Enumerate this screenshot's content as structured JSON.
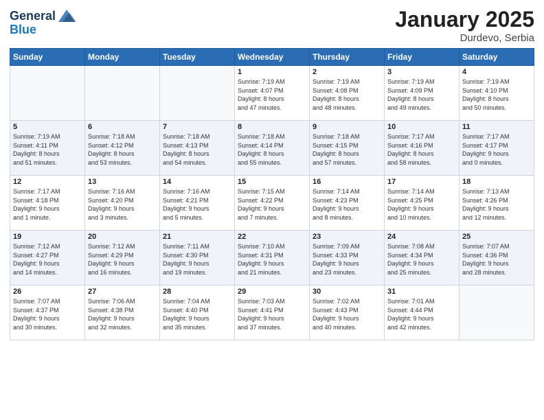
{
  "logo": {
    "line1": "General",
    "line2": "Blue"
  },
  "title": "January 2025",
  "subtitle": "Durdevo, Serbia",
  "days_of_week": [
    "Sunday",
    "Monday",
    "Tuesday",
    "Wednesday",
    "Thursday",
    "Friday",
    "Saturday"
  ],
  "weeks": [
    [
      {
        "day": "",
        "info": ""
      },
      {
        "day": "",
        "info": ""
      },
      {
        "day": "",
        "info": ""
      },
      {
        "day": "1",
        "info": "Sunrise: 7:19 AM\nSunset: 4:07 PM\nDaylight: 8 hours\nand 47 minutes."
      },
      {
        "day": "2",
        "info": "Sunrise: 7:19 AM\nSunset: 4:08 PM\nDaylight: 8 hours\nand 48 minutes."
      },
      {
        "day": "3",
        "info": "Sunrise: 7:19 AM\nSunset: 4:09 PM\nDaylight: 8 hours\nand 49 minutes."
      },
      {
        "day": "4",
        "info": "Sunrise: 7:19 AM\nSunset: 4:10 PM\nDaylight: 8 hours\nand 50 minutes."
      }
    ],
    [
      {
        "day": "5",
        "info": "Sunrise: 7:19 AM\nSunset: 4:11 PM\nDaylight: 8 hours\nand 51 minutes."
      },
      {
        "day": "6",
        "info": "Sunrise: 7:18 AM\nSunset: 4:12 PM\nDaylight: 8 hours\nand 53 minutes."
      },
      {
        "day": "7",
        "info": "Sunrise: 7:18 AM\nSunset: 4:13 PM\nDaylight: 8 hours\nand 54 minutes."
      },
      {
        "day": "8",
        "info": "Sunrise: 7:18 AM\nSunset: 4:14 PM\nDaylight: 8 hours\nand 55 minutes."
      },
      {
        "day": "9",
        "info": "Sunrise: 7:18 AM\nSunset: 4:15 PM\nDaylight: 8 hours\nand 57 minutes."
      },
      {
        "day": "10",
        "info": "Sunrise: 7:17 AM\nSunset: 4:16 PM\nDaylight: 8 hours\nand 58 minutes."
      },
      {
        "day": "11",
        "info": "Sunrise: 7:17 AM\nSunset: 4:17 PM\nDaylight: 9 hours\nand 0 minutes."
      }
    ],
    [
      {
        "day": "12",
        "info": "Sunrise: 7:17 AM\nSunset: 4:18 PM\nDaylight: 9 hours\nand 1 minute."
      },
      {
        "day": "13",
        "info": "Sunrise: 7:16 AM\nSunset: 4:20 PM\nDaylight: 9 hours\nand 3 minutes."
      },
      {
        "day": "14",
        "info": "Sunrise: 7:16 AM\nSunset: 4:21 PM\nDaylight: 9 hours\nand 5 minutes."
      },
      {
        "day": "15",
        "info": "Sunrise: 7:15 AM\nSunset: 4:22 PM\nDaylight: 9 hours\nand 7 minutes."
      },
      {
        "day": "16",
        "info": "Sunrise: 7:14 AM\nSunset: 4:23 PM\nDaylight: 9 hours\nand 8 minutes."
      },
      {
        "day": "17",
        "info": "Sunrise: 7:14 AM\nSunset: 4:25 PM\nDaylight: 9 hours\nand 10 minutes."
      },
      {
        "day": "18",
        "info": "Sunrise: 7:13 AM\nSunset: 4:26 PM\nDaylight: 9 hours\nand 12 minutes."
      }
    ],
    [
      {
        "day": "19",
        "info": "Sunrise: 7:12 AM\nSunset: 4:27 PM\nDaylight: 9 hours\nand 14 minutes."
      },
      {
        "day": "20",
        "info": "Sunrise: 7:12 AM\nSunset: 4:29 PM\nDaylight: 9 hours\nand 16 minutes."
      },
      {
        "day": "21",
        "info": "Sunrise: 7:11 AM\nSunset: 4:30 PM\nDaylight: 9 hours\nand 19 minutes."
      },
      {
        "day": "22",
        "info": "Sunrise: 7:10 AM\nSunset: 4:31 PM\nDaylight: 9 hours\nand 21 minutes."
      },
      {
        "day": "23",
        "info": "Sunrise: 7:09 AM\nSunset: 4:33 PM\nDaylight: 9 hours\nand 23 minutes."
      },
      {
        "day": "24",
        "info": "Sunrise: 7:08 AM\nSunset: 4:34 PM\nDaylight: 9 hours\nand 25 minutes."
      },
      {
        "day": "25",
        "info": "Sunrise: 7:07 AM\nSunset: 4:36 PM\nDaylight: 9 hours\nand 28 minutes."
      }
    ],
    [
      {
        "day": "26",
        "info": "Sunrise: 7:07 AM\nSunset: 4:37 PM\nDaylight: 9 hours\nand 30 minutes."
      },
      {
        "day": "27",
        "info": "Sunrise: 7:06 AM\nSunset: 4:38 PM\nDaylight: 9 hours\nand 32 minutes."
      },
      {
        "day": "28",
        "info": "Sunrise: 7:04 AM\nSunset: 4:40 PM\nDaylight: 9 hours\nand 35 minutes."
      },
      {
        "day": "29",
        "info": "Sunrise: 7:03 AM\nSunset: 4:41 PM\nDaylight: 9 hours\nand 37 minutes."
      },
      {
        "day": "30",
        "info": "Sunrise: 7:02 AM\nSunset: 4:43 PM\nDaylight: 9 hours\nand 40 minutes."
      },
      {
        "day": "31",
        "info": "Sunrise: 7:01 AM\nSunset: 4:44 PM\nDaylight: 9 hours\nand 42 minutes."
      },
      {
        "day": "",
        "info": ""
      }
    ]
  ]
}
